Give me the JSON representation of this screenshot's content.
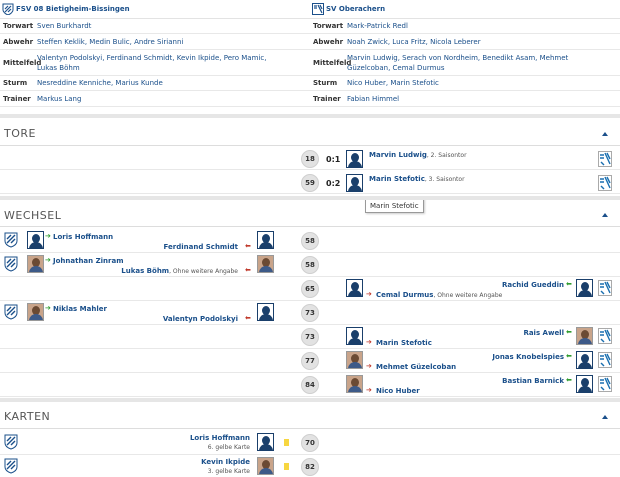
{
  "lineup": {
    "home": {
      "team": "FSV 08 Bietigheim-Bissingen",
      "rows": [
        {
          "role": "Torwart",
          "players": "Sven Burkhardt"
        },
        {
          "role": "Abwehr",
          "players": "Steffen Keklik, Medin Bulic, Andre Sirianni"
        },
        {
          "role": "Mittelfeld",
          "players": "Valentyn Podolskyi, Ferdinand Schmidt, Kevin Ikpide, Pero Mamic, Lukas Böhm"
        },
        {
          "role": "Sturm",
          "players": "Nesreddine Kenniche, Marius Kunde"
        },
        {
          "role": "Trainer",
          "players": "Markus Lang"
        }
      ]
    },
    "away": {
      "team": "SV Oberachern",
      "rows": [
        {
          "role": "Torwart",
          "players": "Mark-Patrick Redl"
        },
        {
          "role": "Abwehr",
          "players": "Noah Zwick, Luca Fritz, Nicola Leberer"
        },
        {
          "role": "Mittelfeld",
          "players": "Marvin Ludwig, Serach von Nordheim, Benedikt Asam, Mehmet Güzelcoban, Cemal Durmus"
        },
        {
          "role": "Sturm",
          "players": "Nico Huber, Marin Stefotic"
        },
        {
          "role": "Trainer",
          "players": "Fabian Himmel"
        }
      ]
    }
  },
  "sections": {
    "goals": "TORE",
    "subs": "WECHSEL",
    "cards": "KARTEN"
  },
  "goals": [
    {
      "minute": "18",
      "score": "0:1",
      "player": "Marvin Ludwig",
      "note": ", 2. Saisontor"
    },
    {
      "minute": "59",
      "score": "0:2",
      "player": "Marin Stefotic",
      "note": ", 3. Saisontor"
    }
  ],
  "tooltip": "Marin Stefotic",
  "subs": [
    {
      "minute": "58",
      "in": "Loris Hoffmann",
      "out": "Ferdinand Schmidt",
      "note": ""
    },
    {
      "minute": "58",
      "in": "Johnathan Zinram",
      "out": "Lukas Böhm",
      "note": ", Ohne weitere Angabe"
    },
    {
      "minute": "65",
      "in": "Rachid Gueddin",
      "out": "Cemal Durmus",
      "note": ", Ohne weitere Angabe"
    },
    {
      "minute": "73",
      "in": "Niklas Mahler",
      "out": "Valentyn Podolskyi",
      "note": ""
    },
    {
      "minute": "73",
      "in": "Rais Awell",
      "out": "Marin Stefotic",
      "note": ""
    },
    {
      "minute": "77",
      "in": "Jonas Knobelspies",
      "out": "Mehmet Güzelcoban",
      "note": ""
    },
    {
      "minute": "84",
      "in": "Bastian Barnick",
      "out": "Nico Huber",
      "note": ""
    }
  ],
  "cards": [
    {
      "minute": "70",
      "player": "Loris Hoffmann",
      "note": "6. gelbe Karte",
      "color": "#f7d640"
    },
    {
      "minute": "82",
      "player": "Kevin Ikpide",
      "note": "3. gelbe Karte",
      "color": "#f7d640"
    }
  ]
}
